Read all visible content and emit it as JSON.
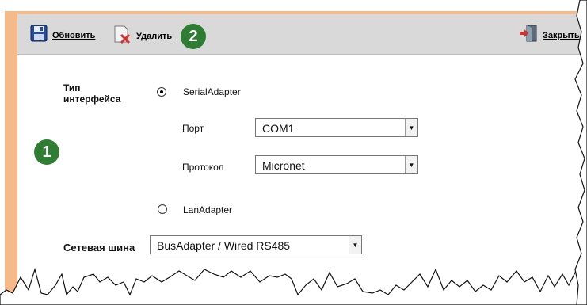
{
  "toolbar": {
    "refresh_label": "Обновить",
    "delete_label": "Удалить",
    "close_label": "Закрыть",
    "callout_number": "2"
  },
  "callout_left": "1",
  "form": {
    "interface_type_label": "Тип интерфейса",
    "serial_option": "SerialAdapter",
    "port_label": "Порт",
    "port_value": "COM1",
    "protocol_label": "Протокол",
    "protocol_value": "Micronet",
    "lan_option": "LanAdapter",
    "bus_label": "Сетевая шина",
    "bus_value": "BusAdapter / Wired RS485",
    "serial_selected": true
  },
  "colors": {
    "accent_green": "#2e7d32",
    "border_orange": "#f5b98a",
    "toolbar_gray": "#d9d9d9"
  }
}
